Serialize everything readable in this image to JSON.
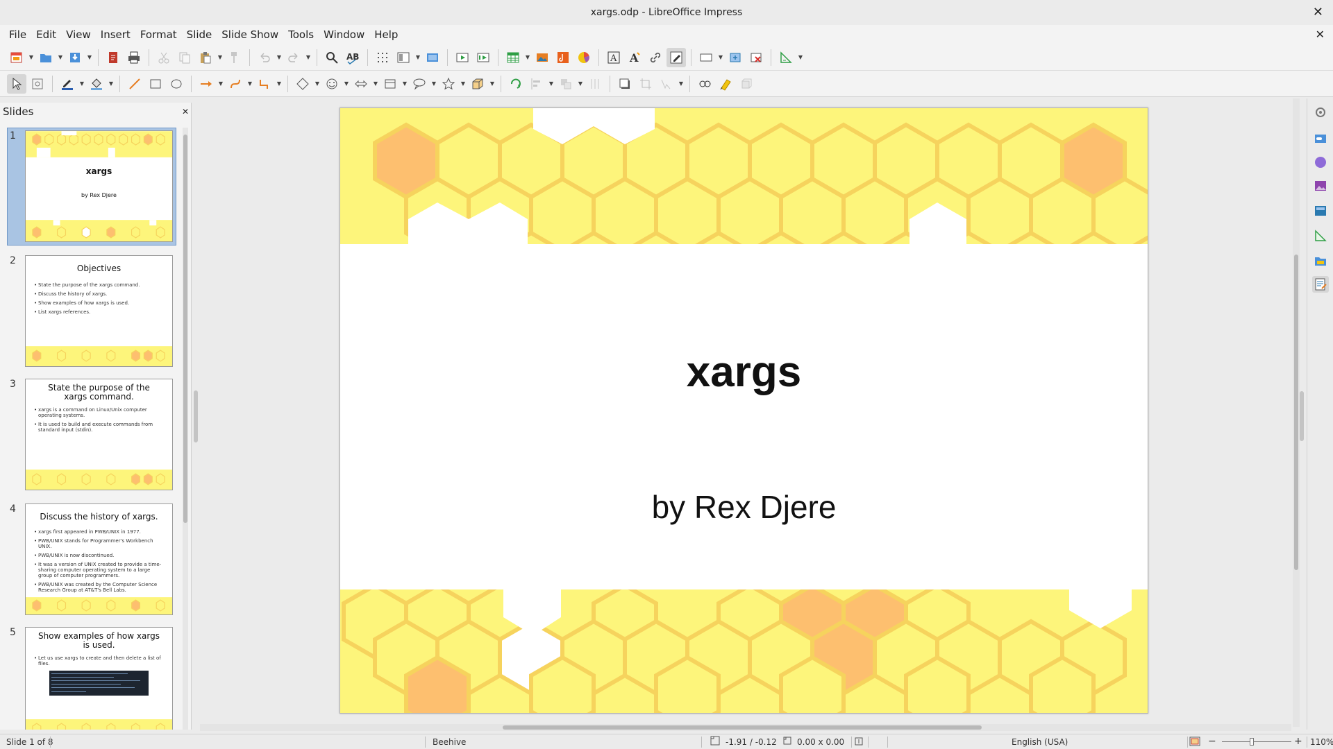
{
  "window": {
    "title": "xargs.odp - LibreOffice Impress",
    "close_glyph": "✕"
  },
  "menubar": {
    "items": [
      "File",
      "Edit",
      "View",
      "Insert",
      "Format",
      "Slide",
      "Slide Show",
      "Tools",
      "Window",
      "Help"
    ],
    "doc_close_glyph": "✕"
  },
  "slides_pane": {
    "title": "Slides",
    "close_glyph": "✕",
    "thumbnails": [
      {
        "number": "1",
        "title": "xargs",
        "subtitle": "by Rex Djere"
      },
      {
        "number": "2",
        "title": "Objectives",
        "bullets": [
          "State the purpose of the xargs command.",
          "Discuss the history of xargs.",
          "Show examples of how xargs is used.",
          "List xargs references."
        ]
      },
      {
        "number": "3",
        "title": "State the purpose of the xargs command.",
        "bullets": [
          "xargs is a command on Linux/Unix computer operating systems.",
          "It is used to build and execute commands from standard input (stdin)."
        ]
      },
      {
        "number": "4",
        "title": "Discuss the history of xargs.",
        "bullets": [
          "xargs first appeared in PWB/UNIX in 1977.",
          "PWB/UNIX stands for Programmer's Workbench UNIX.",
          "PWB/UNIX is now discontinued.",
          "It was a version of UNIX created to provide a time-sharing computer operating system to a large group of computer programmers.",
          "PWB/UNIX was created by the Computer Science Research Group at AT&T's Bell Labs."
        ]
      },
      {
        "number": "5",
        "title": "Show examples of how xargs is used.",
        "bullets": [
          "Let us use xargs to create and then delete a list of files."
        ]
      }
    ]
  },
  "slide": {
    "title": "xargs",
    "subtitle": "by Rex Djere"
  },
  "statusbar": {
    "slide_position": "Slide 1 of 8",
    "master": "Beehive",
    "coordinates": "-1.91 / -0.12",
    "size": "0.00 x 0.00",
    "language": "English (USA)",
    "zoom": "110%",
    "zoom_minus": "−",
    "zoom_plus": "+"
  },
  "colors": {
    "honeycomb_yellow": "#fdf57b",
    "honeycomb_border": "#f6d35d",
    "honeycomb_orange": "#fdbf6f",
    "selection_blue": "#a9c4e3"
  }
}
